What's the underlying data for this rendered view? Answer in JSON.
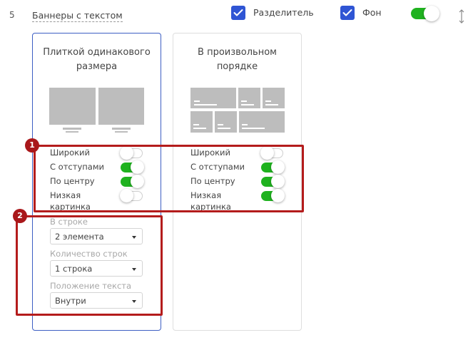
{
  "header": {
    "row_number": "5",
    "block_title": "Баннеры с текстом",
    "checkbox_separator": "Разделитель",
    "checkbox_background": "Фон"
  },
  "cards": {
    "left": {
      "title_line1": "Плиткой одинакового",
      "title_line2": "размера"
    },
    "right": {
      "title_line1": "В произвольном",
      "title_line2": "порядке"
    }
  },
  "options": {
    "left": {
      "wide": {
        "label": "Широкий",
        "on": false
      },
      "padded": {
        "label": "С отступами",
        "on": true
      },
      "center": {
        "label": "По центру",
        "on": true
      },
      "low_image_line1": "Низкая",
      "low_image_line2": "картинка",
      "low_image_on": false
    },
    "right": {
      "wide": {
        "label": "Широкий",
        "on": false
      },
      "padded": {
        "label": "С отступами",
        "on": true
      },
      "center": {
        "label": "По центру",
        "on": true
      },
      "low_image_line1": "Низкая",
      "low_image_line2": "картинка",
      "low_image_on": true
    }
  },
  "selects": {
    "per_row_label": "В строке",
    "per_row_value": "2 элемента",
    "rows_label": "Количество строк",
    "rows_value": "1 строка",
    "text_pos_label": "Положение текста",
    "text_pos_value": "Внутри"
  },
  "annotations": {
    "badge1": "1",
    "badge2": "2"
  },
  "colors": {
    "accent_blue": "#2f55d4",
    "toggle_on": "#1fb21f",
    "annotation_red": "#b41c1c"
  },
  "icons": {
    "check": "check-icon",
    "sort": "sort-arrows-icon"
  }
}
